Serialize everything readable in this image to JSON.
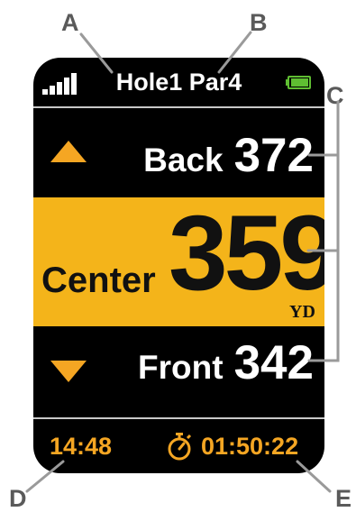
{
  "callouts": {
    "a": "A",
    "b": "B",
    "c": "C",
    "d": "D",
    "e": "E"
  },
  "status": {
    "hole_title": "Hole1 Par4",
    "signal_icon": "signal-bars-icon",
    "battery_icon": "battery-icon"
  },
  "distances": {
    "back_label": "Back",
    "back_value": "372",
    "center_label": "Center",
    "center_value": "359",
    "unit": "YD",
    "front_label": "Front",
    "front_value": "342"
  },
  "footer": {
    "clock": "14:48",
    "timer": "01:50:22",
    "timer_icon": "stopwatch-icon"
  },
  "colors": {
    "accent": "#f5a623",
    "center_band": "#f4b41a",
    "screen": "#000000",
    "battery": "#5fbe32"
  }
}
